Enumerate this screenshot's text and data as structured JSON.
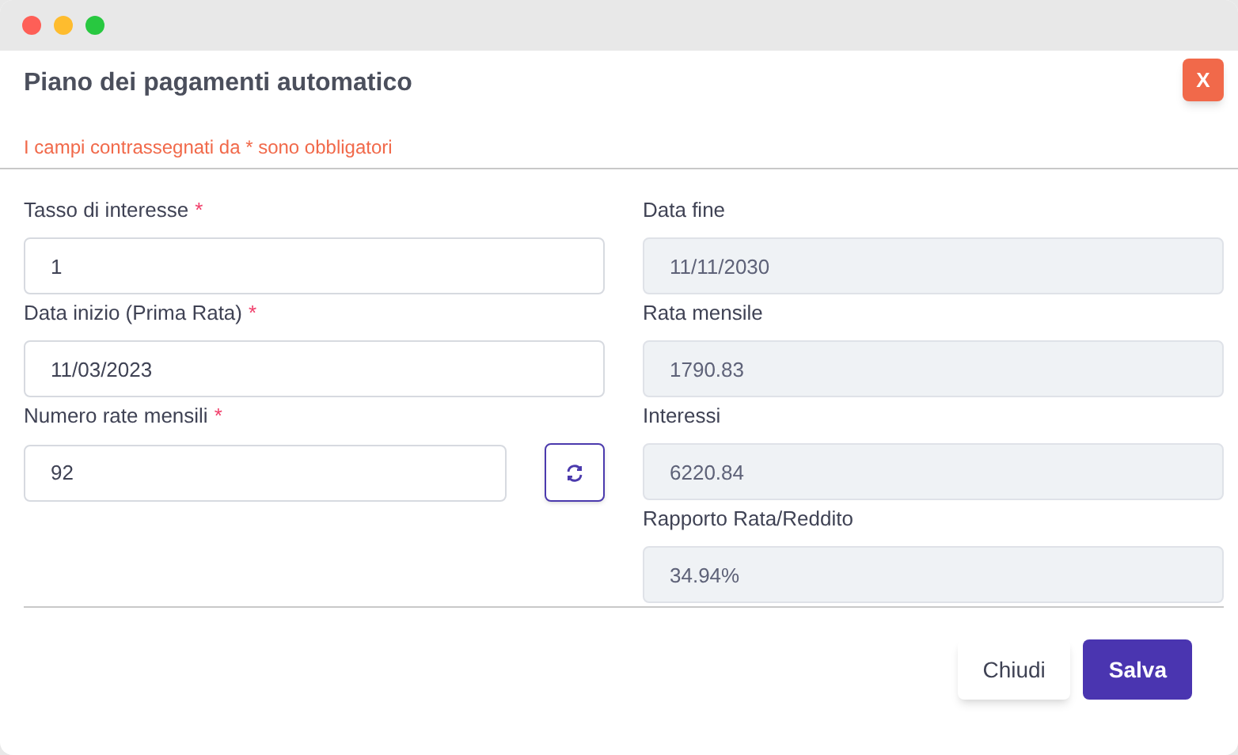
{
  "window": {
    "title": "Piano dei pagamenti automatico",
    "close_label": "X"
  },
  "required_note": "I campi contrassegnati da * sono obbligatori",
  "left_fields": [
    {
      "label": "Tasso di interesse",
      "required": true,
      "value": "1",
      "disabled": false,
      "refresh_button": false
    },
    {
      "label": "Data inizio (Prima Rata)",
      "required": true,
      "value": "11/03/2023",
      "disabled": false,
      "refresh_button": false
    },
    {
      "label": "Numero rate mensili",
      "required": true,
      "value": "92",
      "disabled": false,
      "refresh_button": true
    }
  ],
  "right_fields": [
    {
      "label": "Data fine",
      "required": false,
      "value": "11/11/2030",
      "disabled": true,
      "refresh_button": false
    },
    {
      "label": "Rata mensile",
      "required": false,
      "value": "1790.83",
      "disabled": true,
      "refresh_button": false
    },
    {
      "label": "Interessi",
      "required": false,
      "value": "6220.84",
      "disabled": true,
      "refresh_button": false
    },
    {
      "label": "Rapporto Rata/Reddito",
      "required": false,
      "value": "34.94%",
      "disabled": true,
      "refresh_button": false
    }
  ],
  "required_mark": "*",
  "buttons": [
    {
      "label": "Chiudi",
      "kind": "secondary"
    },
    {
      "label": "Salva",
      "kind": "primary"
    }
  ]
}
